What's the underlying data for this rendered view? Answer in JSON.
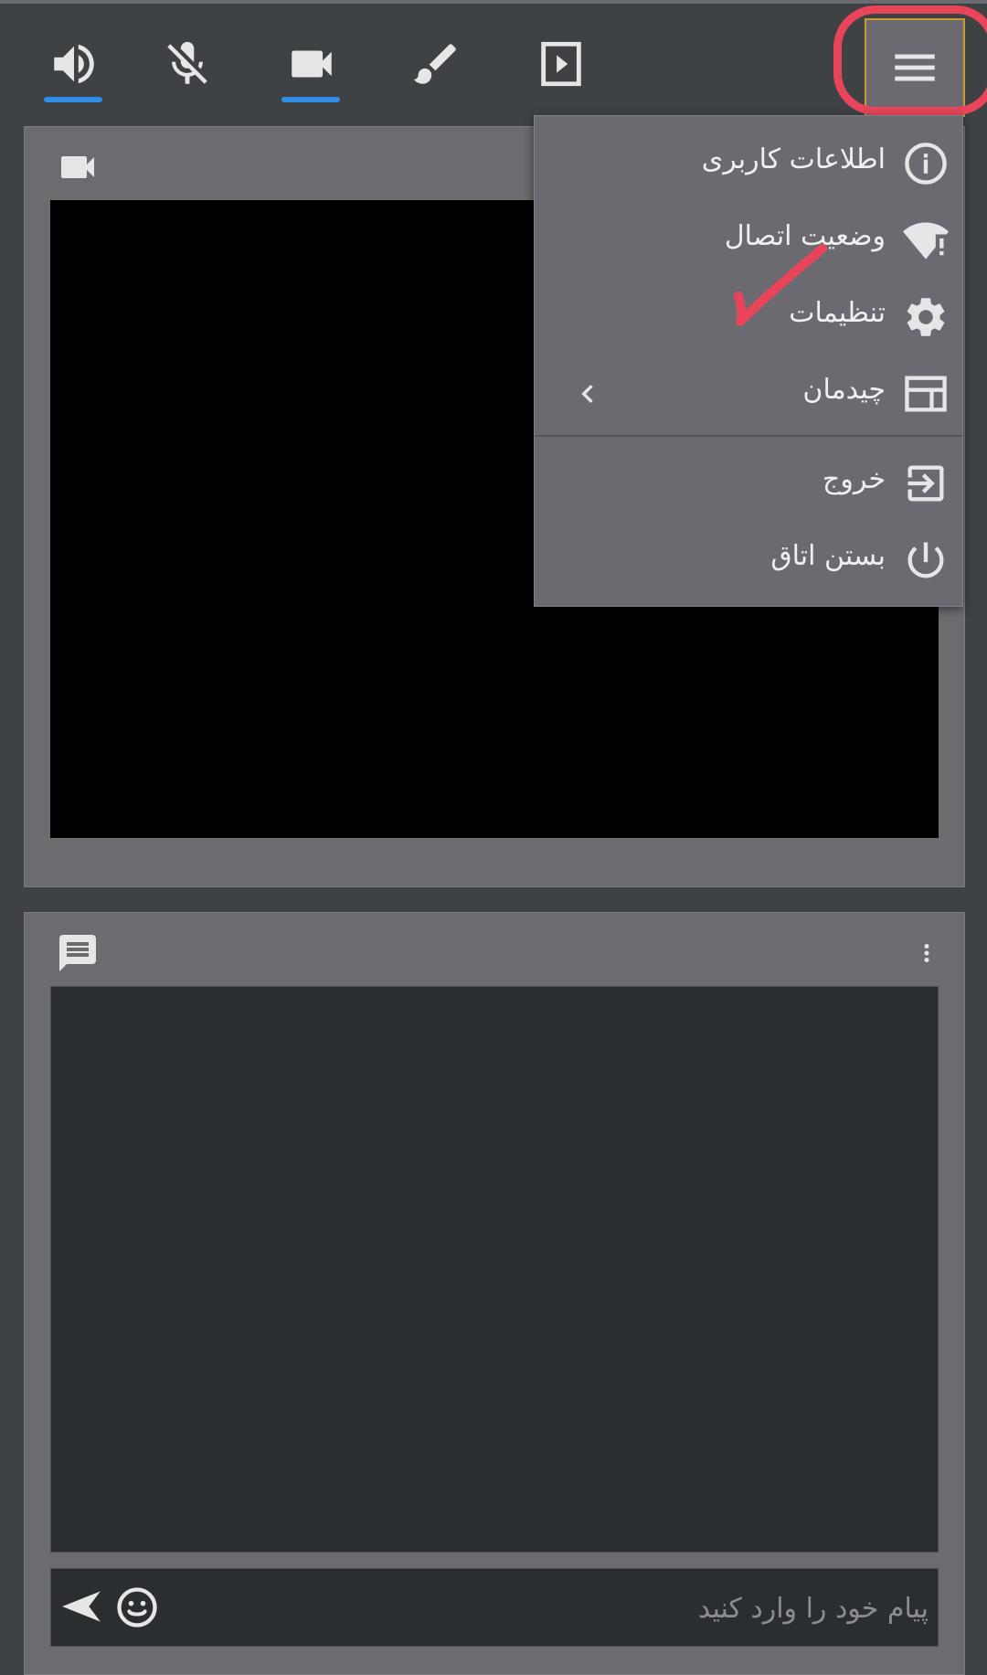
{
  "toolbar": {
    "buttons": [
      {
        "icon": "speaker-icon",
        "active": true
      },
      {
        "icon": "mic-off-icon",
        "active": false
      },
      {
        "icon": "video-camera-icon",
        "active": true
      },
      {
        "icon": "brush-icon",
        "active": false
      },
      {
        "icon": "play-box-icon",
        "active": false
      },
      {
        "icon": "hamburger-menu-icon",
        "active": false
      }
    ],
    "active_color": "#2f8de6"
  },
  "menu": {
    "items": [
      {
        "label": "اطلاعات کاربری",
        "icon": "info-icon"
      },
      {
        "label": "وضعیت اتصال",
        "icon": "wifi-alert-icon"
      },
      {
        "label": "تنظیمات",
        "icon": "gear-icon"
      },
      {
        "label": "چیدمان",
        "icon": "layout-icon",
        "has_submenu": true
      },
      {
        "label": "خروج",
        "icon": "exit-icon"
      },
      {
        "label": "بستن اتاق",
        "icon": "power-icon"
      }
    ]
  },
  "video_panel": {
    "icon": "video-camera-icon"
  },
  "chat_panel": {
    "icon": "chat-icon",
    "input_placeholder": "پیام خود را وارد کنید",
    "input_value": ""
  },
  "annotations": {
    "circle_color": "#e9455a",
    "check_color": "#e9455a"
  }
}
